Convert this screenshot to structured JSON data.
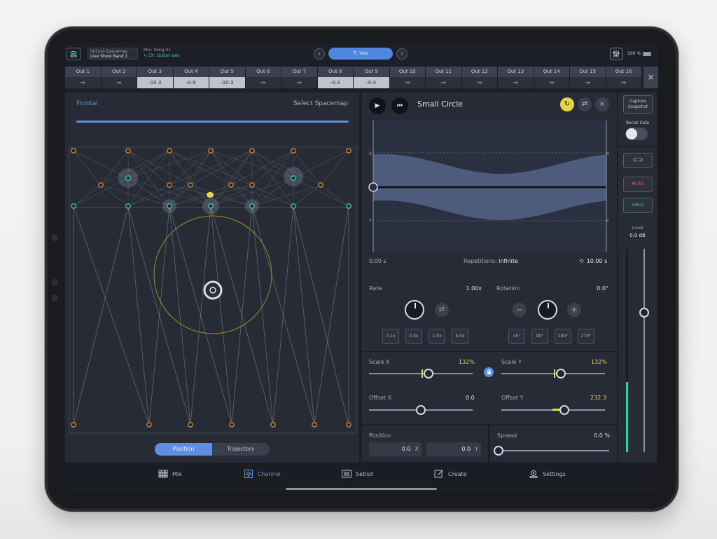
{
  "topbar": {
    "spacemap_line1": "Virtual-Spacemap",
    "spacemap_line2": "Live Show Band 1",
    "mix_line": "Mix: Song 01",
    "ch_line": "Ch: Guitar solo",
    "channel_name": "7: Vox",
    "prev_icon": "chevron-left-icon",
    "next_icon": "chevron-right-icon",
    "battery_text": "100 %"
  },
  "outputs": [
    {
      "name": "Out 1",
      "value": "-∞",
      "active": false
    },
    {
      "name": "Out 2",
      "value": "-∞",
      "active": false
    },
    {
      "name": "Out 3",
      "value": "-10.3",
      "active": true
    },
    {
      "name": "Out 4",
      "value": "-0.9",
      "active": true
    },
    {
      "name": "Out 5",
      "value": "-10.3",
      "active": true
    },
    {
      "name": "Out 6",
      "value": "-∞",
      "active": false
    },
    {
      "name": "Out 7",
      "value": "-∞",
      "active": false
    },
    {
      "name": "Out 8",
      "value": "-0.4",
      "active": true
    },
    {
      "name": "Out 9",
      "value": "-0.4",
      "active": true
    },
    {
      "name": "Out 10",
      "value": "-∞",
      "active": false
    },
    {
      "name": "Out 11",
      "value": "-∞",
      "active": false
    },
    {
      "name": "Out 12",
      "value": "-∞",
      "active": false
    },
    {
      "name": "Out 13",
      "value": "-∞",
      "active": false
    },
    {
      "name": "Out 14",
      "value": "-∞",
      "active": false
    },
    {
      "name": "Out 15",
      "value": "-∞",
      "active": false
    },
    {
      "name": "Out 16",
      "value": "-∞",
      "active": false
    }
  ],
  "spacemap": {
    "view_label": "Frontal",
    "select_label": "Select Spacemap",
    "tabs": [
      "Position",
      "Trajectory"
    ],
    "active_tab": "Position"
  },
  "trajectory": {
    "title": "Small Circle",
    "x_axis_label": "X",
    "y_axis_label": "Y",
    "start_time": "0.00 s",
    "repetitions_label": "Repetitions:",
    "repetitions_value": "infinite",
    "end_time": "10.00 s"
  },
  "rate": {
    "label": "Rate",
    "value": "1.00x",
    "presets": [
      "0.1x",
      "0.5x",
      "1.0x",
      "5.0x"
    ]
  },
  "rotation": {
    "label": "Rotation",
    "value": "0.0°",
    "minus": "−",
    "plus": "+",
    "presets": [
      "45°",
      "90°",
      "180°",
      "270°"
    ]
  },
  "scale": {
    "x_label": "Scale X",
    "x_value": "132%",
    "y_label": "Scale Y",
    "y_value": "132%",
    "link_icon": "link-icon"
  },
  "offset": {
    "x_label": "Offset X",
    "x_value": "0.0",
    "y_label": "Offset Y",
    "y_value": "232.3"
  },
  "position": {
    "label": "Position",
    "x_value": "0.0",
    "x_unit": "X",
    "y_value": "0.0",
    "y_unit": "Y"
  },
  "spread": {
    "label": "Spread",
    "value": "0.0 %",
    "level": 0
  },
  "side": {
    "capture_line1": "Capture",
    "capture_line2": "Snapshot",
    "recall_label": "Recall Safe",
    "mute": "MUTE",
    "solo": "SOLO",
    "level_label": "Level",
    "level_value": "0.0 dB"
  },
  "tabbar": [
    {
      "label": "Mix",
      "icon": "grid-icon"
    },
    {
      "label": "Channel",
      "icon": "channel-icon"
    },
    {
      "label": "Setlist",
      "icon": "setlist-icon"
    },
    {
      "label": "Create",
      "icon": "create-icon"
    },
    {
      "label": "Settings",
      "icon": "settings-icon"
    }
  ],
  "colors": {
    "accent": "#5f8fe0",
    "highlight": "#e6d44a",
    "speaker_orange": "#d08a2a",
    "speaker_green": "#2fd0a8"
  }
}
